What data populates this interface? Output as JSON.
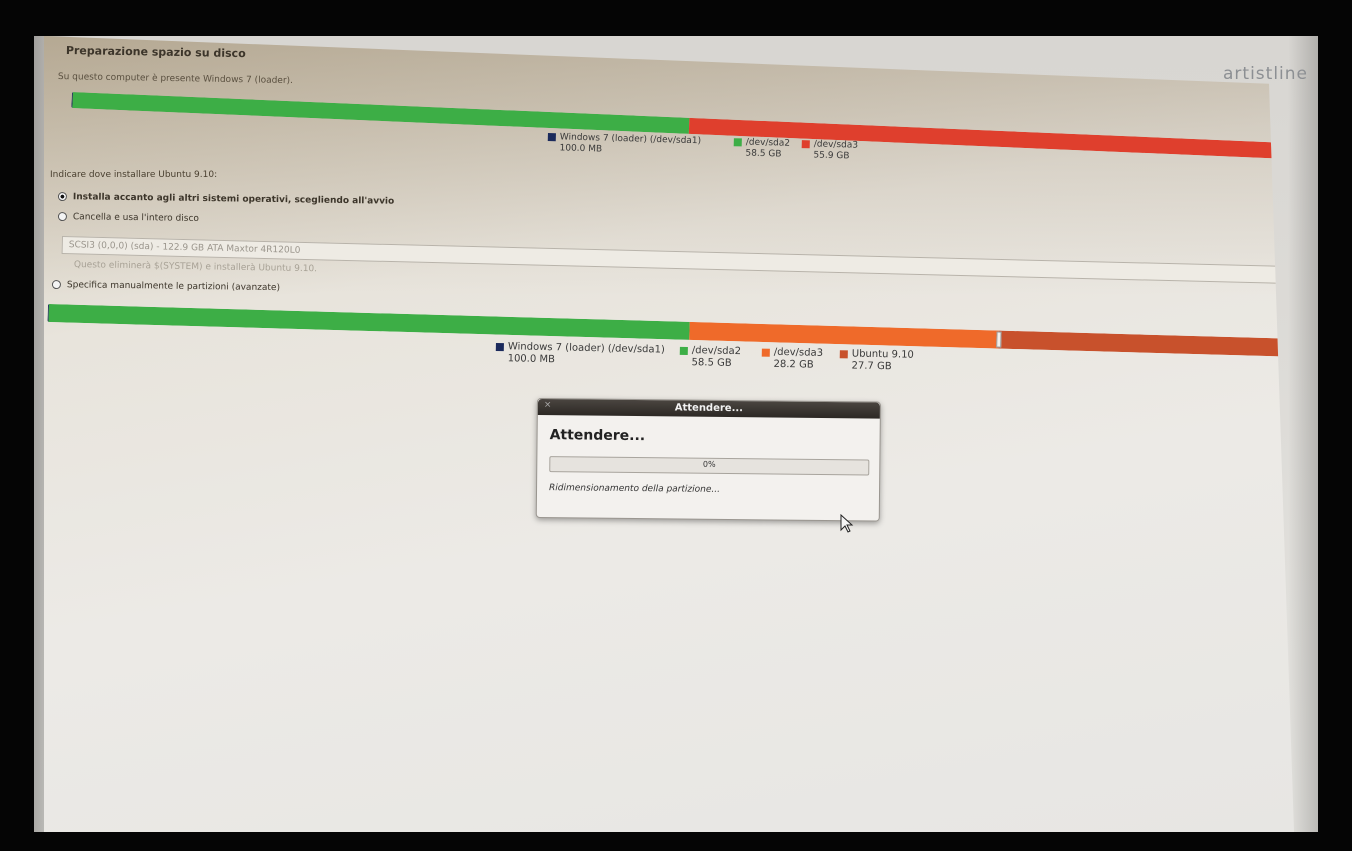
{
  "monitor": {
    "brand": "artistline"
  },
  "installer": {
    "section_title": "Preparazione spazio su disco",
    "intro": "Su questo computer è presente Windows 7 (loader).",
    "question": "Indicare dove installare Ubuntu 9.10:",
    "options": [
      {
        "label": "Installa accanto agli altri sistemi operativi, scegliendo all'avvio",
        "selected": true
      },
      {
        "label": "Cancella e usa l'intero disco",
        "selected": false
      },
      {
        "label": "Specifica manualmente le partizioni (avanzate)",
        "selected": false
      }
    ],
    "disk_select": "SCSI3 (0,0,0) (sda) - 122.9 GB ATA Maxtor 4R120L0",
    "warning": "Questo eliminerà $(SYSTEM) e installerà Ubuntu 9.10."
  },
  "partitions_before": [
    {
      "name": "Windows 7 (loader) (/dev/sda1)",
      "size": "100.0 MB",
      "color": "#1b2a5c",
      "share": 0.0008
    },
    {
      "name": "/dev/sda2",
      "size": "58.5 GB",
      "color": "#3dae46",
      "share": 0.5113
    },
    {
      "name": "/dev/sda3",
      "size": "55.9 GB",
      "color": "#df3f2d",
      "share": 0.4879
    }
  ],
  "partitions_after": [
    {
      "name": "Windows 7 (loader) (/dev/sda1)",
      "size": "100.0 MB",
      "color": "#1b2a5c",
      "share": 0.0008
    },
    {
      "name": "/dev/sda2",
      "size": "58.5 GB",
      "color": "#3dae46",
      "share": 0.5113
    },
    {
      "name": "/dev/sda3",
      "size": "28.2 GB",
      "color": "#ef6a2a",
      "share": 0.2465
    },
    {
      "name": "Ubuntu 9.10",
      "size": "27.7 GB",
      "color": "#c8512c",
      "share": 0.2414
    }
  ],
  "dialog": {
    "title": "Attendere...",
    "heading": "Attendere...",
    "progress_value": 0,
    "progress_text": "0%",
    "status": "Ridimensionamento della partizione..."
  }
}
